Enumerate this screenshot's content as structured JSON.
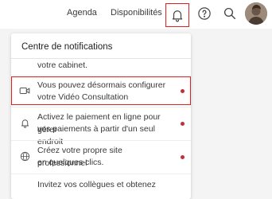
{
  "topbar": {
    "agenda": "Agenda",
    "disponibilites": "Disponibilités"
  },
  "notifications": {
    "title": "Centre de notifications",
    "items": [
      {
        "line1": "votre cabinet.",
        "line2": ""
      },
      {
        "line1": "Vous pouvez désormais configurer",
        "line2": "votre Vidéo Consultation",
        "icon": "video-camera-icon",
        "unread": true
      },
      {
        "line1": "Activez le paiement en ligne pour gérer",
        "line2": "vos paiements à partir d'un seul endroit",
        "icon": "bell-icon",
        "unread": true
      },
      {
        "line1": "Créez votre propre site professionnel",
        "line2": "en quelques clics.",
        "icon": "globe-icon",
        "unread": true
      },
      {
        "line1": "Invitez vos collègues et obtenez",
        "line2": ""
      }
    ]
  },
  "colors": {
    "highlight": "#e02020",
    "unread_dot": "#c0303a"
  }
}
